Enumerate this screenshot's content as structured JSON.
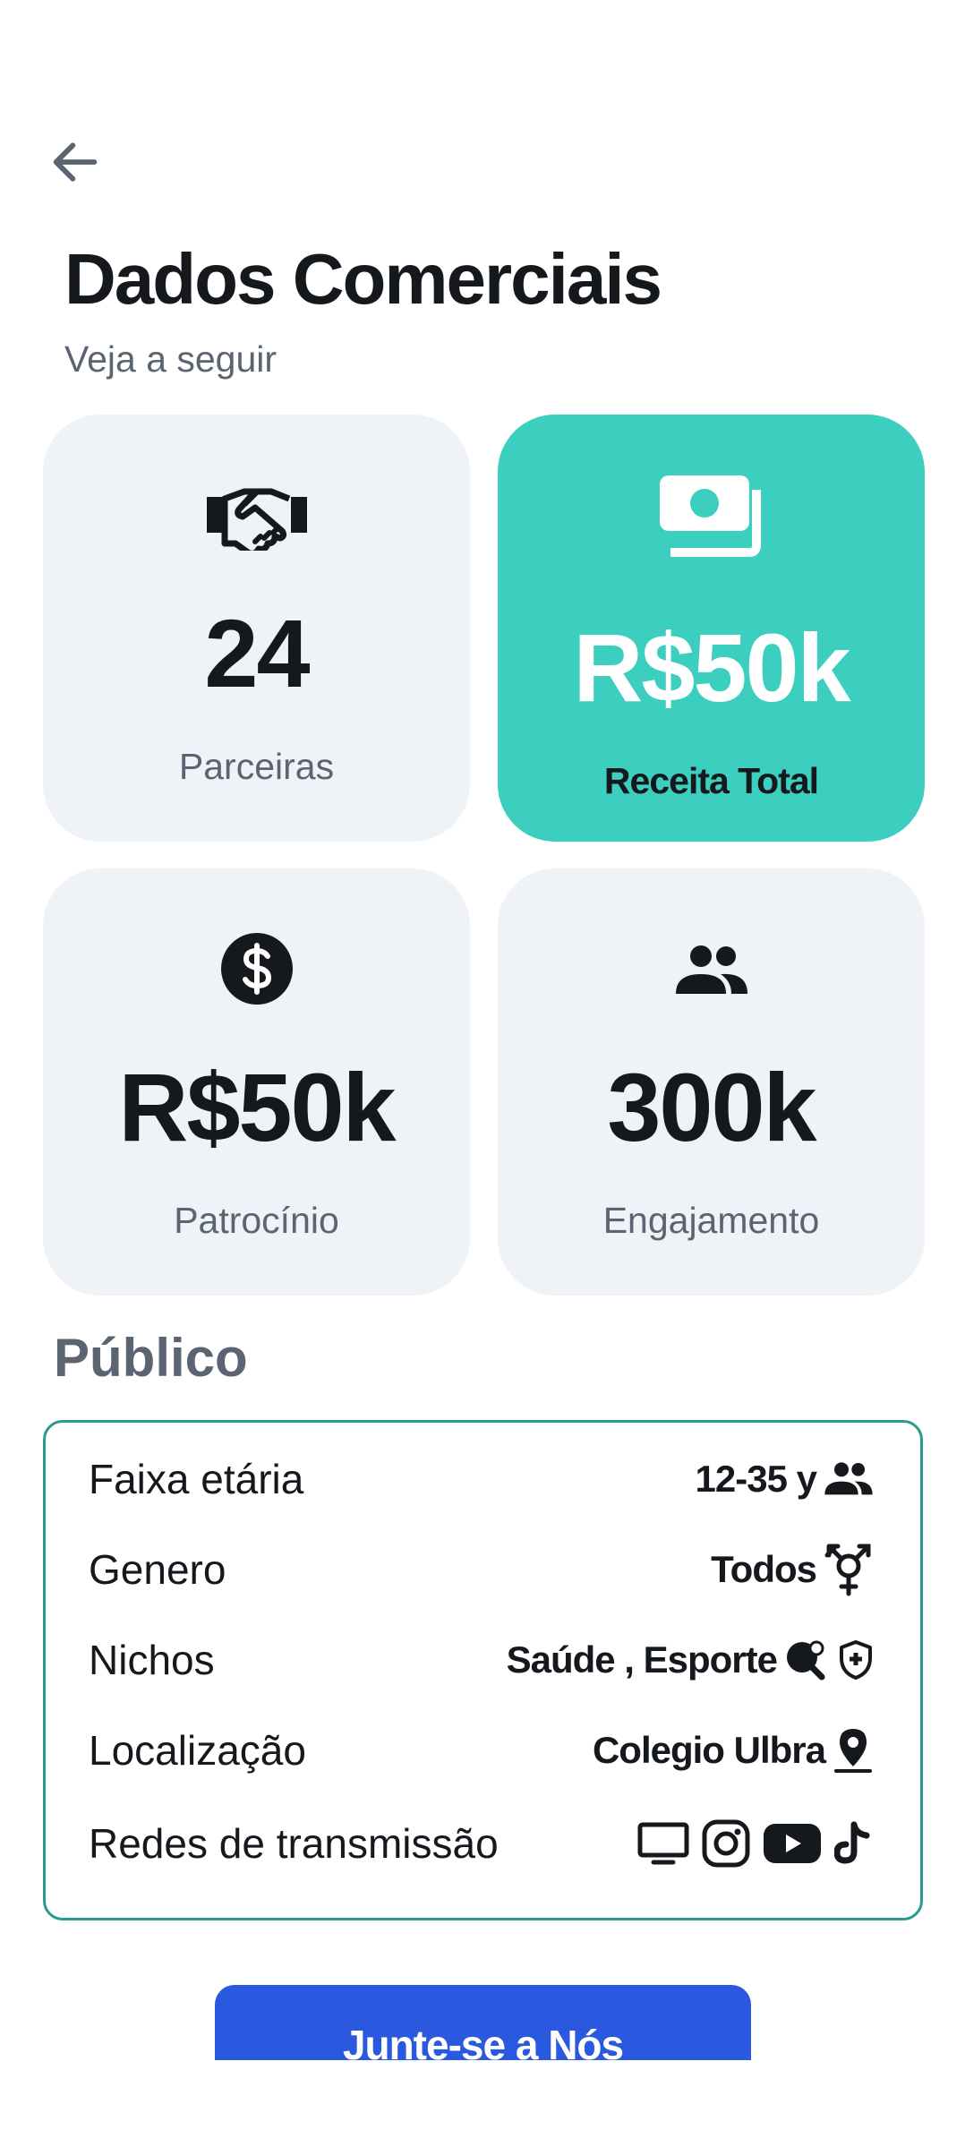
{
  "header": {
    "back_icon": "arrow-left-icon",
    "title": "Dados Comerciais",
    "subtitle": "Veja a seguir"
  },
  "stats": {
    "partners": {
      "icon": "handshake-icon",
      "value": "24",
      "label": "Parceiras"
    },
    "revenue": {
      "icon": "money-icon",
      "value": "R$50k",
      "label": "Receita Total"
    },
    "sponsorship": {
      "icon": "dollar-circle-icon",
      "value": "R$50k",
      "label": "Patrocínio"
    },
    "engagement": {
      "icon": "people-icon",
      "value": "300k",
      "label": "Engajamento"
    }
  },
  "audience": {
    "title": "Público",
    "rows": [
      {
        "label": "Faixa etária",
        "value": "12-35 y",
        "icons": [
          "people-icon"
        ]
      },
      {
        "label": "Genero",
        "value": "Todos",
        "icons": [
          "transgender-icon"
        ]
      },
      {
        "label": "Nichos",
        "value": "Saúde , Esporte",
        "icons": [
          "ping-pong-icon",
          "health-shield-icon"
        ]
      },
      {
        "label": "Localização",
        "value": "Colegio Ulbra",
        "icons": [
          "location-pin-icon"
        ]
      },
      {
        "label": "Redes de transmissão",
        "value": "",
        "icons": [
          "tv-icon",
          "instagram-icon",
          "youtube-icon",
          "tiktok-icon"
        ]
      }
    ]
  },
  "cta": {
    "label": "Junte-se a Nós"
  },
  "colors": {
    "accent": "#3ccfbf",
    "card_bg": "#eff2f7",
    "button": "#2a58de",
    "border": "#2a9a8e",
    "text_dark": "#15191e",
    "text_muted": "#5b6572"
  }
}
